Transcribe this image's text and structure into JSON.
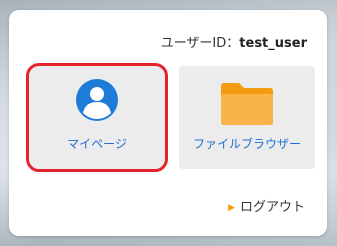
{
  "header": {
    "user_label": "ユーザーID：",
    "user_id": "test_user"
  },
  "tiles": {
    "mypage": {
      "label": "マイページ",
      "icon": "user-avatar-icon",
      "selected": true
    },
    "files": {
      "label": "ファイルブラウザー",
      "icon": "folder-icon"
    }
  },
  "logout": {
    "label": "ログアウト",
    "icon": "right-triangle-icon"
  },
  "colors": {
    "accent_link": "#1e6fd1",
    "selection_outline": "#e3242b",
    "avatar": "#1f7bd8",
    "folder": "#f39c12",
    "tile_bg": "#ececec"
  }
}
